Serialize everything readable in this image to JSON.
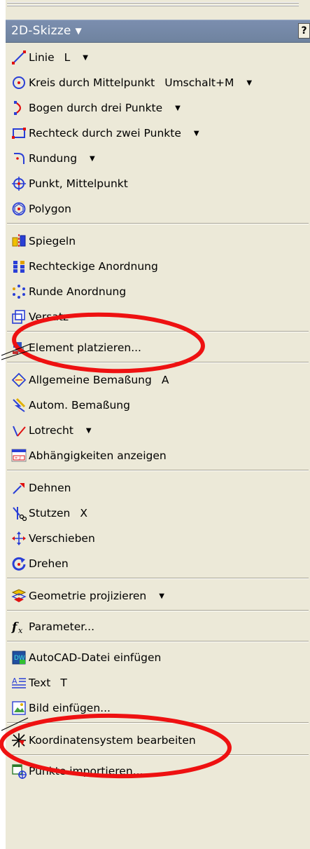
{
  "panel": {
    "title": "2D-Skizze",
    "title_caret": "▼",
    "help_label": "?"
  },
  "items": [
    {
      "label": "Linie",
      "shortcut": "L",
      "arrow": "▼",
      "icon": "line-icon"
    },
    {
      "label": "Kreis durch Mittelpunkt",
      "shortcut": "Umschalt+M",
      "arrow": "▼",
      "icon": "circle-center-icon"
    },
    {
      "label": "Bogen durch drei Punkte",
      "shortcut": "",
      "arrow": "▼",
      "icon": "arc-three-point-icon"
    },
    {
      "label": "Rechteck durch zwei Punkte",
      "shortcut": "",
      "arrow": "▼",
      "icon": "rectangle-icon"
    },
    {
      "label": "Rundung",
      "shortcut": "",
      "arrow": "▼",
      "icon": "fillet-icon"
    },
    {
      "label": "Punkt, Mittelpunkt",
      "shortcut": "",
      "arrow": "",
      "icon": "point-icon"
    },
    {
      "label": "Polygon",
      "shortcut": "",
      "arrow": "",
      "icon": "polygon-icon"
    },
    {
      "label": "Spiegeln",
      "shortcut": "",
      "arrow": "",
      "icon": "mirror-icon"
    },
    {
      "label": "Rechteckige Anordnung",
      "shortcut": "",
      "arrow": "",
      "icon": "rectangular-pattern-icon"
    },
    {
      "label": "Runde Anordnung",
      "shortcut": "",
      "arrow": "",
      "icon": "circular-pattern-icon"
    },
    {
      "label": "Versatz",
      "shortcut": "",
      "arrow": "",
      "icon": "offset-icon"
    },
    {
      "label": "Element platzieren...",
      "shortcut": "",
      "arrow": "",
      "icon": "place-feature-icon"
    },
    {
      "label": "Allgemeine Bemaßung",
      "shortcut": "A",
      "arrow": "",
      "icon": "general-dimension-icon"
    },
    {
      "label": "Autom. Bemaßung",
      "shortcut": "",
      "arrow": "",
      "icon": "auto-dimension-icon"
    },
    {
      "label": "Lotrecht",
      "shortcut": "",
      "arrow": "▼",
      "icon": "perpendicular-icon"
    },
    {
      "label": "Abhängigkeiten anzeigen",
      "shortcut": "",
      "arrow": "",
      "icon": "show-constraints-icon"
    },
    {
      "label": "Dehnen",
      "shortcut": "",
      "arrow": "",
      "icon": "extend-icon"
    },
    {
      "label": "Stutzen",
      "shortcut": "X",
      "arrow": "",
      "icon": "trim-icon"
    },
    {
      "label": "Verschieben",
      "shortcut": "",
      "arrow": "",
      "icon": "move-icon"
    },
    {
      "label": "Drehen",
      "shortcut": "",
      "arrow": "",
      "icon": "rotate-icon"
    },
    {
      "label": "Geometrie projizieren",
      "shortcut": "",
      "arrow": "▼",
      "icon": "project-geometry-icon"
    },
    {
      "label": "Parameter...",
      "shortcut": "",
      "arrow": "",
      "icon": "parameters-fx-icon"
    },
    {
      "label": "AutoCAD-Datei einfügen",
      "shortcut": "",
      "arrow": "",
      "icon": "insert-autocad-icon"
    },
    {
      "label": "Text",
      "shortcut": "T",
      "arrow": "",
      "icon": "text-icon"
    },
    {
      "label": "Bild einfügen...",
      "shortcut": "",
      "arrow": "",
      "icon": "insert-image-icon"
    },
    {
      "label": "Koordinatensystem bearbeiten",
      "shortcut": "",
      "arrow": "",
      "icon": "edit-coordinate-system-icon"
    },
    {
      "label": "Punkte importieren...",
      "shortcut": "",
      "arrow": "",
      "icon": "import-points-icon"
    }
  ],
  "colors": {
    "panel_bg": "#ece9d8",
    "header_bg": "#7589a8",
    "annotation": "#ee1111"
  }
}
